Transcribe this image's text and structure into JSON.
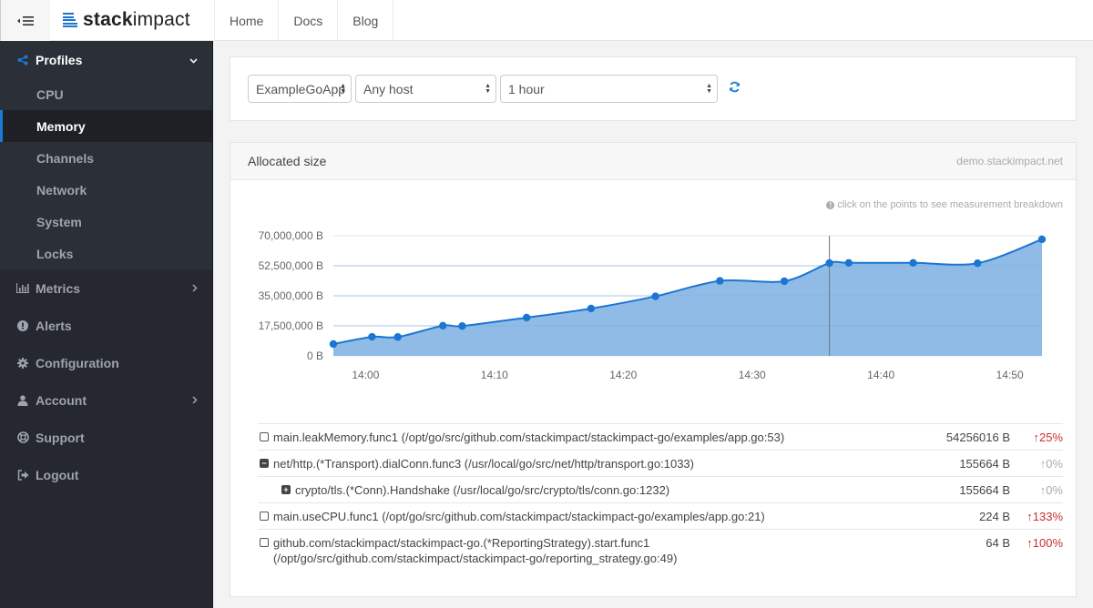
{
  "header": {
    "brand_bold": "stack",
    "brand_light": "impact",
    "nav": [
      {
        "label": "Home"
      },
      {
        "label": "Docs"
      },
      {
        "label": "Blog"
      }
    ]
  },
  "sidebar": {
    "profiles": {
      "label": "Profiles",
      "icon": "share-nodes-icon",
      "expanded": true,
      "items": [
        {
          "label": "CPU",
          "active": false
        },
        {
          "label": "Memory",
          "active": true
        },
        {
          "label": "Channels",
          "active": false
        },
        {
          "label": "Network",
          "active": false
        },
        {
          "label": "System",
          "active": false
        },
        {
          "label": "Locks",
          "active": false
        }
      ]
    },
    "items": [
      {
        "label": "Metrics",
        "icon": "bar-chart-icon",
        "has_children": true
      },
      {
        "label": "Alerts",
        "icon": "exclamation-circle-icon",
        "has_children": false
      },
      {
        "label": "Configuration",
        "icon": "gear-icon",
        "has_children": false
      },
      {
        "label": "Account",
        "icon": "user-icon",
        "has_children": true
      },
      {
        "label": "Support",
        "icon": "life-ring-icon",
        "has_children": false
      },
      {
        "label": "Logout",
        "icon": "sign-out-icon",
        "has_children": false
      }
    ]
  },
  "filters": {
    "app": "ExampleGoApp",
    "host": "Any host",
    "period": "1 hour"
  },
  "panel": {
    "title": "Allocated size",
    "site": "demo.stackimpact.net",
    "hint": "click on the points to see measurement breakdown"
  },
  "chart_data": {
    "type": "area",
    "title": "Allocated size",
    "xlabel": "",
    "ylabel": "",
    "x_ticks": [
      "14:00",
      "14:10",
      "14:20",
      "14:30",
      "14:40",
      "14:50"
    ],
    "y_ticks": [
      "0 B",
      "17,500,000 B",
      "35,000,000 B",
      "52,500,000 B",
      "70,000,000 B"
    ],
    "ylim": [
      0,
      70000000
    ],
    "xlim_minutes": [
      57.5,
      112.5
    ],
    "grid": true,
    "selected_x_minute": 96,
    "series": [
      {
        "name": "Allocated size",
        "color": "#1a76d2",
        "fill": "#8fbbe6",
        "x_minutes": [
          57.5,
          60.5,
          62.5,
          66,
          67.5,
          72.5,
          77.5,
          82.5,
          87.5,
          92.5,
          96,
          97.5,
          102.5,
          107.5,
          112.5
        ],
        "values": [
          6900000,
          11100000,
          11000000,
          17600000,
          17400000,
          22300000,
          27600000,
          34700000,
          43700000,
          43500000,
          54100000,
          54200000,
          54200000,
          54000000,
          67900000
        ]
      }
    ]
  },
  "breakdown": [
    {
      "name": "main.leakMemory.func1 (/opt/go/src/github.com/stackimpact/stackimpact-go/examples/app.go:53)",
      "size": "54256016 B",
      "delta": "25%",
      "trend": "up",
      "toggle": "empty",
      "indent": false
    },
    {
      "name": "net/http.(*Transport).dialConn.func3 (/usr/local/go/src/net/http/transport.go:1033)",
      "size": "155664 B",
      "delta": "0%",
      "trend": "flat",
      "toggle": "minus",
      "indent": false
    },
    {
      "name": "crypto/tls.(*Conn).Handshake (/usr/local/go/src/crypto/tls/conn.go:1232)",
      "size": "155664 B",
      "delta": "0%",
      "trend": "flat",
      "toggle": "plus",
      "indent": true
    },
    {
      "name": "main.useCPU.func1 (/opt/go/src/github.com/stackimpact/stackimpact-go/examples/app.go:21)",
      "size": "224 B",
      "delta": "133%",
      "trend": "up",
      "toggle": "empty",
      "indent": false
    },
    {
      "name": "github.com/stackimpact/stackimpact-go.(*ReportingStrategy).start.func1 (/opt/go/src/github.com/stackimpact/stackimpact-go/reporting_strategy.go:49)",
      "size": "64 B",
      "delta": "100%",
      "trend": "up",
      "toggle": "empty",
      "indent": false
    }
  ]
}
